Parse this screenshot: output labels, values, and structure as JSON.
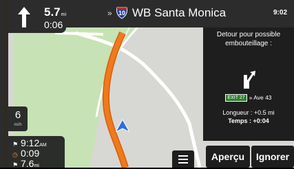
{
  "maneuver": {
    "distance": "5.7",
    "distance_unit": "mi",
    "time": "0:06",
    "icon": "arrow-up-icon"
  },
  "topbar": {
    "chevron": "»",
    "route_shield": "10",
    "street": "WB Santa Monica",
    "clock": "9:02"
  },
  "detour": {
    "title_line1": "Detour pour possible",
    "title_line2": "embouteillage :",
    "exit_badge": "EXIT 27",
    "exit_text": "» Ave 43",
    "length": "Longueur : +0.5 mi",
    "time": "Temps : +0:04"
  },
  "buttons": {
    "preview": "Aperçu",
    "ignore": "Ignorer"
  },
  "speed": {
    "value": "6",
    "unit": "mi/h"
  },
  "trip": {
    "arrival": "9:12",
    "arrival_suffix": "AM",
    "remaining_time": "0:09",
    "remaining_distance": "7.6",
    "remaining_distance_unit": "mi"
  },
  "colors": {
    "route": "#f07a1a",
    "panel": "#1e1e1e",
    "map_bg": "#d7d8d3",
    "park": "#c7e2b4",
    "position_marker": "#2b6fe0"
  }
}
